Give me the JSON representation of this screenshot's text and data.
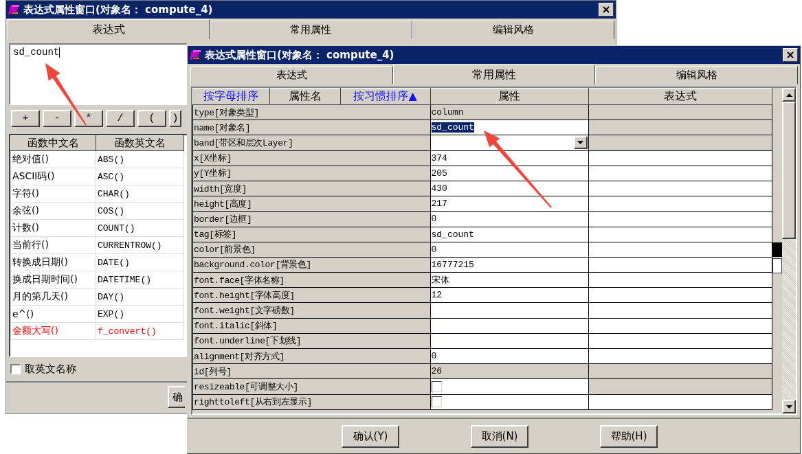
{
  "back_window": {
    "title": "表达式属性窗口(对象名： compute_4)",
    "tabs": [
      {
        "label": "表达式",
        "selected": true
      },
      {
        "label": "常用属性",
        "selected": false
      },
      {
        "label": "编辑风格",
        "selected": false
      }
    ],
    "expression": "sd_count",
    "operators": [
      "+",
      "-",
      "*",
      "/",
      "(",
      ")"
    ],
    "function_table": {
      "columns": [
        "函数中文名",
        "函数英文名"
      ],
      "rows": [
        {
          "chinese": "绝对值()",
          "english": "ABS()",
          "color": "#000000"
        },
        {
          "chinese": "ASCII码()",
          "english": "ASC()",
          "color": "#000000"
        },
        {
          "chinese": "字符()",
          "english": "CHAR()",
          "color": "#000000"
        },
        {
          "chinese": "余弦()",
          "english": "COS()",
          "color": "#000000"
        },
        {
          "chinese": "计数()",
          "english": "COUNT()",
          "color": "#000000"
        },
        {
          "chinese": "当前行()",
          "english": "CURRENTROW()",
          "color": "#000000"
        },
        {
          "chinese": "转换成日期()",
          "english": "DATE()",
          "color": "#000000"
        },
        {
          "chinese": "换成日期时间()",
          "english": "DATETIME()",
          "color": "#000000"
        },
        {
          "chinese": "月的第几天()",
          "english": "DAY()",
          "color": "#000000"
        },
        {
          "chinese": "e^()",
          "english": "EXP()",
          "color": "#000000"
        },
        {
          "chinese": "金额大写()",
          "english": "f_convert()",
          "color": "#ff0000"
        }
      ]
    },
    "english_names_checkbox": {
      "label": "取英文名称",
      "checked": false
    },
    "buttons": [
      "确"
    ]
  },
  "front_window": {
    "title": "表达式属性窗口(对象名： compute_4)",
    "tabs": [
      {
        "label": "表达式",
        "selected": false
      },
      {
        "label": "常用属性",
        "selected": true
      },
      {
        "label": "编辑风格",
        "selected": false
      }
    ],
    "grid": {
      "header": [
        {
          "label": "按字母排序",
          "kind": "sort"
        },
        {
          "label": "属性名",
          "kind": "title"
        },
        {
          "label": "按习惯排序▲",
          "kind": "sort"
        },
        {
          "label": "属性",
          "kind": "title"
        },
        {
          "label": "表达式",
          "kind": "title"
        }
      ],
      "rows": [
        {
          "name": "type[对象类型]",
          "kind": "text",
          "value": "column",
          "value_readonly": true,
          "value_selected": false,
          "expression_readonly": true
        },
        {
          "name": "name[对象名]",
          "kind": "text",
          "value": "sd_count",
          "value_readonly": false,
          "value_selected": true,
          "expression_readonly": true
        },
        {
          "name": "band[带区和层次Layer]",
          "kind": "dropdown",
          "value_readonly": false,
          "expression_readonly": true
        },
        {
          "name": "x[X坐标]",
          "kind": "text",
          "value": "374",
          "value_readonly": false,
          "value_selected": false,
          "expression_readonly": false
        },
        {
          "name": "y[Y坐标]",
          "kind": "text",
          "value": "205",
          "value_readonly": false,
          "value_selected": false,
          "expression_readonly": false
        },
        {
          "name": "width[宽度]",
          "kind": "text",
          "value": "430",
          "value_readonly": false,
          "value_selected": false,
          "expression_readonly": false
        },
        {
          "name": "height[高度]",
          "kind": "text",
          "value": "217",
          "value_readonly": false,
          "value_selected": false,
          "expression_readonly": false
        },
        {
          "name": "border[边框]",
          "kind": "text",
          "value": "0",
          "value_readonly": false,
          "value_selected": false,
          "expression_readonly": false
        },
        {
          "name": "tag[标签]",
          "kind": "text",
          "value": "sd_count",
          "value_readonly": false,
          "value_selected": false,
          "expression_readonly": false
        },
        {
          "name": "color[前景色]",
          "kind": "text",
          "value": "0",
          "value_readonly": false,
          "value_selected": false,
          "expression_readonly": false
        },
        {
          "name": "background.color[背景色]",
          "kind": "text",
          "value": "16777215",
          "value_readonly": false,
          "value_selected": false,
          "expression_readonly": false
        },
        {
          "name": "font.face[字体名称]",
          "kind": "text",
          "value": "宋体",
          "value_readonly": false,
          "value_selected": false,
          "expression_readonly": false
        },
        {
          "name": "font.height[字体高度]",
          "kind": "text",
          "value": "12",
          "value_readonly": false,
          "value_selected": false,
          "expression_readonly": false
        },
        {
          "name": "font.weight[文字磅数]",
          "kind": "text",
          "value_readonly": false,
          "expression_readonly": false
        },
        {
          "name": "font.italic[斜体]",
          "kind": "text",
          "value_readonly": false,
          "expression_readonly": false
        },
        {
          "name": "font.underline[下划线]",
          "kind": "text",
          "value_readonly": false,
          "expression_readonly": false
        },
        {
          "name": "alignment[对齐方式]",
          "kind": "text",
          "value": "0",
          "value_readonly": false,
          "value_selected": false,
          "expression_readonly": false
        },
        {
          "name": "id[列号]",
          "kind": "text",
          "value": "26",
          "value_readonly": true,
          "value_selected": false,
          "expression_readonly": true
        },
        {
          "name": "resizeable[可调整大小]",
          "kind": "checkbox",
          "checked": false,
          "value_readonly": false,
          "expression_readonly": true
        },
        {
          "name": "righttoleft[从右到左显示]",
          "kind": "checkbox",
          "checked": false,
          "value_readonly": false,
          "expression_readonly": false
        }
      ]
    },
    "buttons": [
      "确认(Y)",
      "取消(N)",
      "帮助(H)"
    ]
  }
}
